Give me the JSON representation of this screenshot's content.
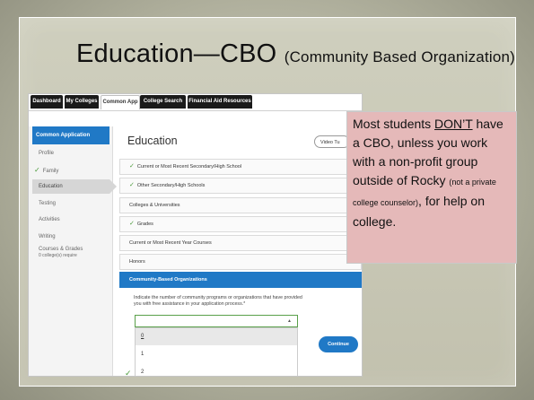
{
  "slide": {
    "title": "Education—CBO",
    "title_sub": "(Community Based Organization)"
  },
  "tabs": [
    "Dashboard",
    "My Colleges",
    "Common App",
    "College Search",
    "Financial Aid Resources"
  ],
  "active_tab": "Common App",
  "sidebar": {
    "header": "Common Application",
    "items": [
      {
        "label": "Profile",
        "checked": false
      },
      {
        "label": "Family",
        "checked": true
      },
      {
        "label": "Education",
        "checked": false,
        "active": true
      },
      {
        "label": "Testing",
        "checked": false
      },
      {
        "label": "Activities",
        "checked": false
      },
      {
        "label": "Writing",
        "checked": false
      },
      {
        "label": "Courses & Grades",
        "checked": false
      },
      {
        "label": "0 college(s) require",
        "checked": false
      }
    ]
  },
  "main": {
    "title": "Education",
    "video_button": "Video Tu",
    "sections": [
      {
        "label": "Current or Most Recent Secondary/High School",
        "checked": true
      },
      {
        "label": "Other Secondary/High Schools",
        "checked": true
      },
      {
        "label": "Colleges & Universities",
        "checked": false
      },
      {
        "label": "Grades",
        "checked": true
      },
      {
        "label": "Current or Most Recent Year Courses",
        "checked": false
      },
      {
        "label": "Honors",
        "checked": false
      },
      {
        "label": "Community-Based Organizations",
        "checked": false,
        "active": true
      }
    ],
    "question": "Indicate the number of community programs or organizations that have provided you with free assistance in your application process.*",
    "dropdown_options": [
      "0",
      "1",
      "2"
    ],
    "dropdown_highlighted": "0",
    "continue_label": "Continue"
  },
  "callout": {
    "part1": "Most students ",
    "emph": "DON’T",
    "part2": " have a CBO, unless you work with a non-profit group outside of Rocky ",
    "small": "(not a private college counselor)",
    "part3": ", for help on college."
  },
  "icons": {
    "check": "checkmark-icon",
    "caret": "caret-up-icon"
  },
  "colors": {
    "accent_blue": "#2079c6",
    "check_green": "#4a9a3a",
    "callout_bg": "#e5b9b9"
  }
}
